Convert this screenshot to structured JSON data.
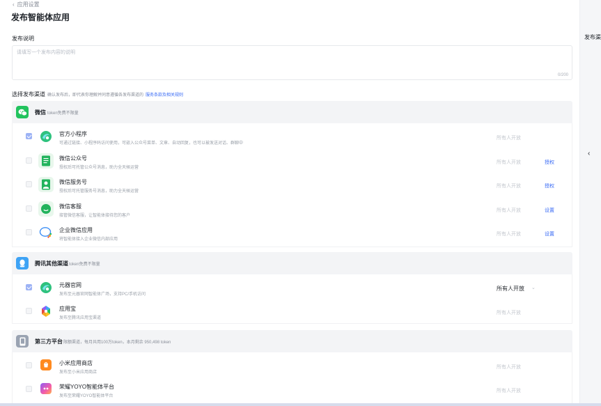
{
  "breadcrumb": {
    "back_label": "应用设置"
  },
  "page_title": "发布智能体应用",
  "description": {
    "label": "发布说明",
    "placeholder": "请填写一个发布内容的说明",
    "counter": "0/200"
  },
  "channels": {
    "label": "选择发布渠道",
    "hint": "确认发布后，即代表你理解并同意遵循各发布渠道的",
    "policy_link": "服务条款及相关规则"
  },
  "groups": [
    {
      "name": "微信",
      "note": "token免费不限量",
      "icon": "wechat-icon",
      "color": "#22c35e",
      "items": [
        {
          "name": "官方小程序",
          "desc": "可通过链接、小程序码访问使用，可嵌入公众号菜单、文章、自动回复，也可以被发送对话、群聊中",
          "scope": "所有人开放",
          "action": "",
          "checked": true,
          "icon": "yuanqi-icon"
        },
        {
          "name": "微信公众号",
          "desc": "授权后可托管公众号消息，助力全天候运营",
          "scope": "所有人开放",
          "action": "授权",
          "checked": false,
          "icon": "wechat-official-account-icon"
        },
        {
          "name": "微信服务号",
          "desc": "授权后可托管服务号消息，助力全天候运营",
          "scope": "所有人开放",
          "action": "授权",
          "checked": false,
          "icon": "wechat-service-account-icon"
        },
        {
          "name": "微信客服",
          "desc": "接管微信客服，让智能体接待您的客户",
          "scope": "所有人开放",
          "action": "设置",
          "checked": false,
          "icon": "wechat-customer-service-icon"
        },
        {
          "name": "企业微信应用",
          "desc": "将智能体接入企业微信内部应用",
          "scope": "所有人开放",
          "action": "设置",
          "checked": false,
          "icon": "wecom-icon"
        }
      ]
    },
    {
      "name": "腾讯其他渠道",
      "note": "token免费不限量",
      "icon": "tencent-channel-icon",
      "color": "#3ea3f5",
      "items": [
        {
          "name": "元器官网",
          "desc": "发布至元器官网智能体广场，支持PC/手机访问",
          "scope": "所有人开放",
          "action": "",
          "checked": true,
          "icon": "yuanqi-icon"
        },
        {
          "name": "应用宝",
          "desc": "发布至腾讯应用宝渠道",
          "scope": "所有人开放",
          "action": "",
          "checked": false,
          "icon": "yingyongbao-icon"
        }
      ]
    },
    {
      "name": "第三方平台",
      "note": "限额渠道，每月共用100万token，本月剩余 950,498 token",
      "icon": "phone-icon",
      "color": "#9aa3b2",
      "items": [
        {
          "name": "小米应用商店",
          "desc": "发布至小米应用商店",
          "scope": "所有人开放",
          "action": "",
          "checked": false,
          "icon": "xiaomi-store-icon"
        },
        {
          "name": "荣耀YOYO智能体平台",
          "desc": "发布至荣耀YOYO智能体平台",
          "scope": "所有人开放",
          "action": "",
          "checked": false,
          "icon": "honor-yoyo-icon"
        }
      ]
    }
  ],
  "right_panel": {
    "title": "发布渠道"
  }
}
